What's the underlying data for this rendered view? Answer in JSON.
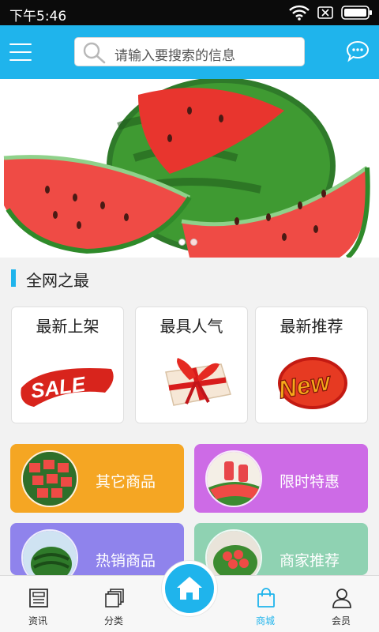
{
  "status_bar": {
    "time": "下午5:46"
  },
  "search": {
    "placeholder": "请输入要搜索的信息"
  },
  "section": {
    "title": "全网之最"
  },
  "cards": [
    {
      "label": "最新上架",
      "badge": "SALE"
    },
    {
      "label": "最具人气"
    },
    {
      "label": "最新推荐",
      "badge": "New"
    }
  ],
  "tiles": [
    {
      "label": "其它商品",
      "color": "#f5a623"
    },
    {
      "label": "限时特惠",
      "color": "#cd6be6"
    },
    {
      "label": "热销商品",
      "color": "#8f83ec"
    },
    {
      "label": "商家推荐",
      "color": "#8fd2b2"
    }
  ],
  "bottom_nav": [
    {
      "label": "资讯",
      "icon": "news-icon",
      "active": false
    },
    {
      "label": "分类",
      "icon": "category-icon",
      "active": false
    },
    {
      "label": "",
      "icon": "home-icon",
      "active": false
    },
    {
      "label": "商城",
      "icon": "shopping-bag-icon",
      "active": true
    },
    {
      "label": "会员",
      "icon": "user-icon",
      "active": false
    }
  ],
  "colors": {
    "accent": "#1fb4ec",
    "status_bar": "#0b0b0b"
  }
}
